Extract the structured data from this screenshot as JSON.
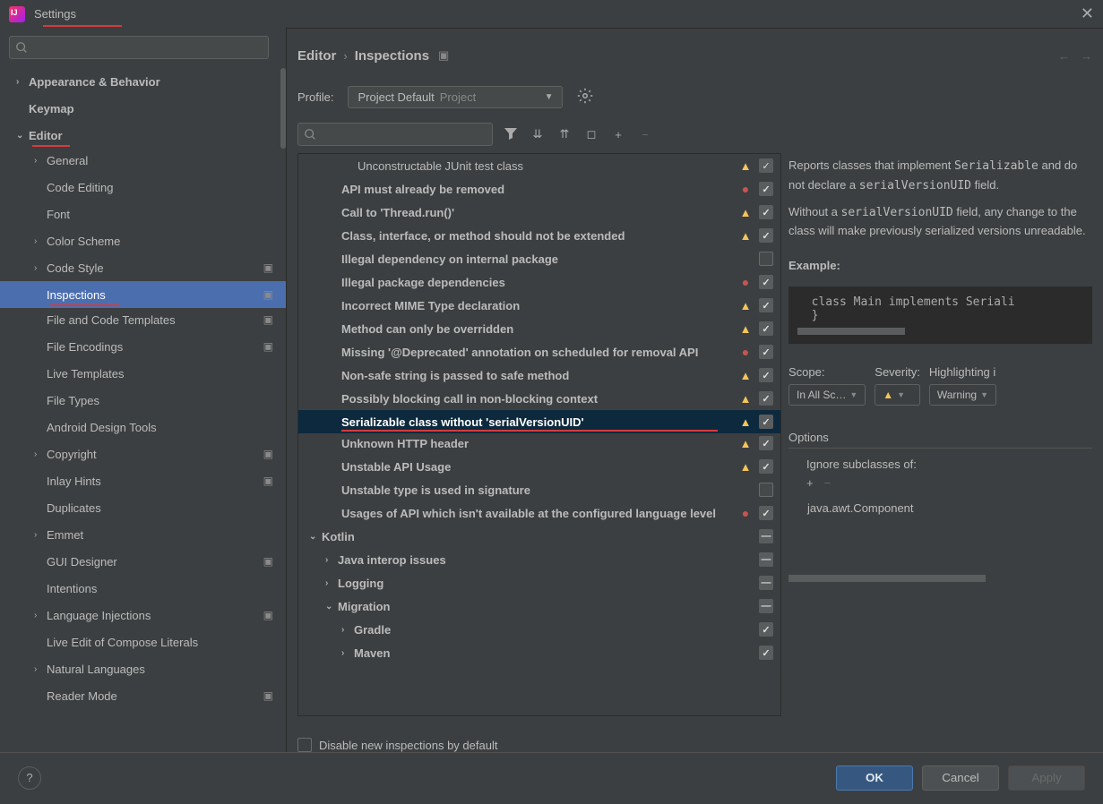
{
  "window": {
    "title": "Settings"
  },
  "breadcrumb": {
    "main": "Editor",
    "sub": "Inspections"
  },
  "profile": {
    "label": "Profile:",
    "selected": "Project Default",
    "scope": "Project"
  },
  "sidebar": {
    "items": [
      {
        "label": "Appearance & Behavior",
        "chev": ">",
        "bold": true,
        "l": 0
      },
      {
        "label": "Keymap",
        "chev": "",
        "bold": true,
        "l": 0
      },
      {
        "label": "Editor",
        "chev": "v",
        "bold": true,
        "l": 0,
        "red": true
      },
      {
        "label": "General",
        "chev": ">",
        "l": 1
      },
      {
        "label": "Code Editing",
        "chev": "",
        "l": 1
      },
      {
        "label": "Font",
        "chev": "",
        "l": 1
      },
      {
        "label": "Color Scheme",
        "chev": ">",
        "l": 1
      },
      {
        "label": "Code Style",
        "chev": ">",
        "l": 1,
        "trail": "▣"
      },
      {
        "label": "Inspections",
        "chev": "",
        "l": 1,
        "trail": "▣",
        "sel": true,
        "red": true
      },
      {
        "label": "File and Code Templates",
        "chev": "",
        "l": 1,
        "trail": "▣"
      },
      {
        "label": "File Encodings",
        "chev": "",
        "l": 1,
        "trail": "▣"
      },
      {
        "label": "Live Templates",
        "chev": "",
        "l": 1
      },
      {
        "label": "File Types",
        "chev": "",
        "l": 1
      },
      {
        "label": "Android Design Tools",
        "chev": "",
        "l": 1
      },
      {
        "label": "Copyright",
        "chev": ">",
        "l": 1,
        "trail": "▣"
      },
      {
        "label": "Inlay Hints",
        "chev": "",
        "l": 1,
        "trail": "▣"
      },
      {
        "label": "Duplicates",
        "chev": "",
        "l": 1
      },
      {
        "label": "Emmet",
        "chev": ">",
        "l": 1
      },
      {
        "label": "GUI Designer",
        "chev": "",
        "l": 1,
        "trail": "▣"
      },
      {
        "label": "Intentions",
        "chev": "",
        "l": 1
      },
      {
        "label": "Language Injections",
        "chev": ">",
        "l": 1,
        "trail": "▣"
      },
      {
        "label": "Live Edit of Compose Literals",
        "chev": "",
        "l": 1
      },
      {
        "label": "Natural Languages",
        "chev": ">",
        "l": 1
      },
      {
        "label": "Reader Mode",
        "chev": "",
        "l": 1,
        "trail": "▣"
      }
    ]
  },
  "inspections": {
    "rows": [
      {
        "label": "Unconstructable JUnit test class",
        "l": 3,
        "sev": "warn",
        "chk": "on"
      },
      {
        "label": "API must already be removed",
        "l": 2,
        "sev": "err",
        "chk": "on"
      },
      {
        "label": "Call to 'Thread.run()'",
        "l": 2,
        "sev": "warn",
        "chk": "on"
      },
      {
        "label": "Class, interface, or method should not be extended",
        "l": 2,
        "sev": "warn",
        "chk": "on"
      },
      {
        "label": "Illegal dependency on internal package",
        "l": 2,
        "sev": "",
        "chk": "off"
      },
      {
        "label": "Illegal package dependencies",
        "l": 2,
        "sev": "err",
        "chk": "on"
      },
      {
        "label": "Incorrect MIME Type declaration",
        "l": 2,
        "sev": "warn",
        "chk": "on"
      },
      {
        "label": "Method can only be overridden",
        "l": 2,
        "sev": "warn",
        "chk": "on"
      },
      {
        "label": "Missing '@Deprecated' annotation on scheduled for removal API",
        "l": 2,
        "sev": "err",
        "chk": "on"
      },
      {
        "label": "Non-safe string is passed to safe method",
        "l": 2,
        "sev": "warn",
        "chk": "on"
      },
      {
        "label": "Possibly blocking call in non-blocking context",
        "l": 2,
        "sev": "warn",
        "chk": "on"
      },
      {
        "label": "Serializable class without 'serialVersionUID'",
        "l": 2,
        "sev": "warn",
        "chk": "on",
        "sel": true,
        "red": true
      },
      {
        "label": "Unknown HTTP header",
        "l": 2,
        "sev": "warn",
        "chk": "on"
      },
      {
        "label": "Unstable API Usage",
        "l": 2,
        "sev": "warn",
        "chk": "on"
      },
      {
        "label": "Unstable type is used in signature",
        "l": 2,
        "sev": "",
        "chk": "off"
      },
      {
        "label": "Usages of API which isn't available at the configured language level",
        "l": 2,
        "sev": "err",
        "chk": "on"
      },
      {
        "label": "Kotlin",
        "l": 0,
        "sev": "",
        "chk": "dash",
        "chev": "v"
      },
      {
        "label": "Java interop issues",
        "l": 1,
        "sev": "",
        "chk": "dash",
        "chev": ">"
      },
      {
        "label": "Logging",
        "l": 1,
        "sev": "",
        "chk": "dash",
        "chev": ">"
      },
      {
        "label": "Migration",
        "l": 1,
        "sev": "",
        "chk": "dash",
        "chev": "v"
      },
      {
        "label": "Gradle",
        "l": 2,
        "sev": "",
        "chk": "on",
        "chev": ">",
        "bold": true
      },
      {
        "label": "Maven",
        "l": 2,
        "sev": "",
        "chk": "on",
        "chev": ">",
        "bold": true
      }
    ]
  },
  "details": {
    "desc1": "Reports classes that implement ",
    "desc1code": "Serializable",
    "desc1b": " and do not declare a ",
    "desc1code2": "serialVersionUID",
    "desc1c": " field.",
    "desc2a": "Without a ",
    "desc2code": "serialVersionUID",
    "desc2b": " field, any change to the class will make previously serialized versions unreadable.",
    "example_label": "Example:",
    "example_code": "  class Main implements Seriali\n  }",
    "scope_label": "Scope:",
    "scope_val": "In All Sc…",
    "severity_label": "Severity:",
    "highlight_label": "Highlighting i",
    "highlight_val": "Warning",
    "options_label": "Options",
    "ignore_label": "Ignore subclasses of:",
    "ignore_item": "java.awt.Component"
  },
  "disable": {
    "label": "Disable new inspections by default"
  },
  "buttons": {
    "ok": "OK",
    "cancel": "Cancel",
    "apply": "Apply"
  }
}
